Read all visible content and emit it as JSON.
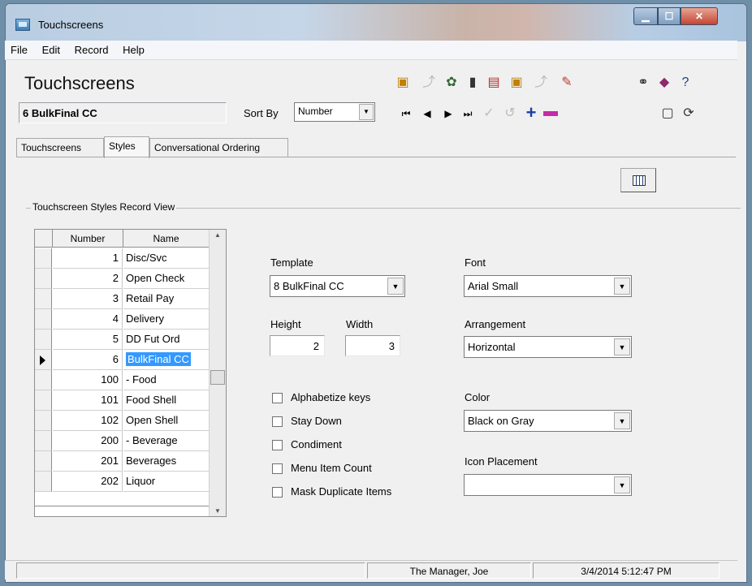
{
  "window": {
    "title": "Touchscreens"
  },
  "menu": [
    "File",
    "Edit",
    "Record",
    "Help"
  ],
  "header": {
    "title": "Touchscreens",
    "record": "6 BulkFinal CC",
    "sort_label": "Sort By",
    "sort_value": "Number"
  },
  "tabs": [
    "Touchscreens",
    "Styles",
    "Conversational Ordering"
  ],
  "active_tab": "Styles",
  "group_label": "Touchscreen Styles Record View",
  "grid": {
    "columns": [
      "Number",
      "Name"
    ],
    "rows": [
      {
        "number": "1",
        "name": "Disc/Svc"
      },
      {
        "number": "2",
        "name": "Open Check"
      },
      {
        "number": "3",
        "name": "Retail Pay"
      },
      {
        "number": "4",
        "name": "Delivery"
      },
      {
        "number": "5",
        "name": "DD Fut Ord"
      },
      {
        "number": "6",
        "name": "BulkFinal CC"
      },
      {
        "number": "100",
        "name": "- Food"
      },
      {
        "number": "101",
        "name": "Food Shell"
      },
      {
        "number": "102",
        "name": "Open Shell"
      },
      {
        "number": "200",
        "name": "- Beverage"
      },
      {
        "number": "201",
        "name": "Beverages"
      },
      {
        "number": "202",
        "name": "Liquor"
      }
    ],
    "selected_index": 5
  },
  "form": {
    "template_label": "Template",
    "template_value": "8  BulkFinal CC",
    "font_label": "Font",
    "font_value": "Arial Small",
    "height_label": "Height",
    "height_value": "2",
    "width_label": "Width",
    "width_value": "3",
    "arrangement_label": "Arrangement",
    "arrangement_value": "Horizontal",
    "color_label": "Color",
    "color_value": "Black on Gray",
    "icon_label": "Icon Placement",
    "icon_value": "",
    "checkboxes": [
      "Alphabetize keys",
      "Stay Down",
      "Condiment",
      "Menu Item Count",
      "Mask Duplicate Items"
    ]
  },
  "status": {
    "user": "The Manager, Joe",
    "datetime": "3/4/2014 5:12:47 PM"
  },
  "icons": {
    "toolbar_top": [
      "find-record-icon",
      "copy-disabled-icon",
      "wizard-icon",
      "delete-icon",
      "new-record-icon",
      "find-icon",
      "paste-disabled-icon",
      "pencil-icon",
      "binoculars-icon",
      "book-icon",
      "help-pointer-icon"
    ],
    "toolbar_nav": [
      "first-icon",
      "prev-icon",
      "next-icon",
      "last-icon",
      "edit-disabled-icon",
      "undo-disabled-icon",
      "add-icon",
      "remove-icon",
      "window-icon",
      "refresh-icon"
    ]
  }
}
